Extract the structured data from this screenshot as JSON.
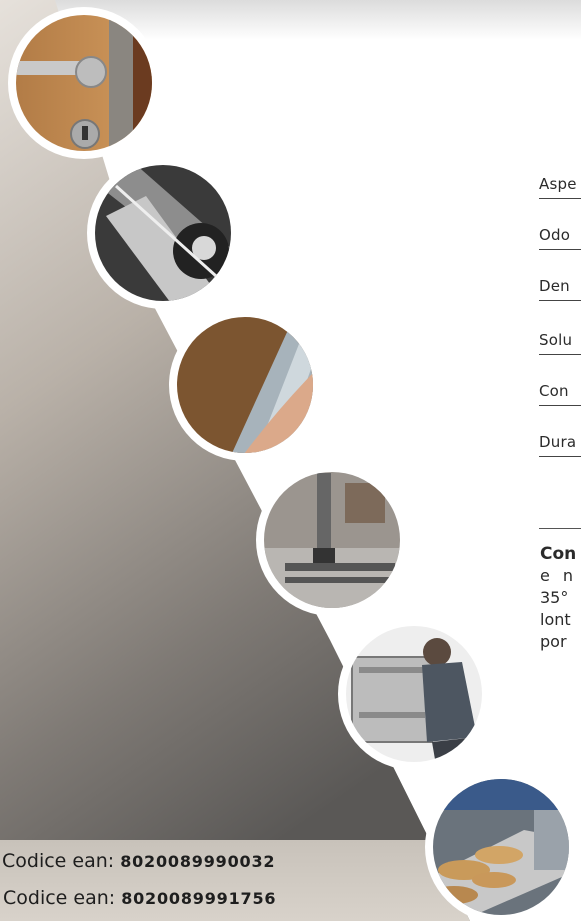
{
  "specs": [
    "Aspe",
    "Odo",
    "Den",
    "Solu",
    "Con",
    "Dura"
  ],
  "notes": [
    "Con",
    "e n",
    "35°",
    "lont",
    "por"
  ],
  "ean": [
    {
      "label": "Codice ean:",
      "code": "8020089990032"
    },
    {
      "label": "Codice ean:",
      "code": "8020089991756"
    }
  ],
  "icons": [
    "door-handle-icon",
    "mechanism-icon",
    "window-seal-icon",
    "sewing-machine-icon",
    "dishwasher-icon",
    "industrial-oven-icon"
  ]
}
